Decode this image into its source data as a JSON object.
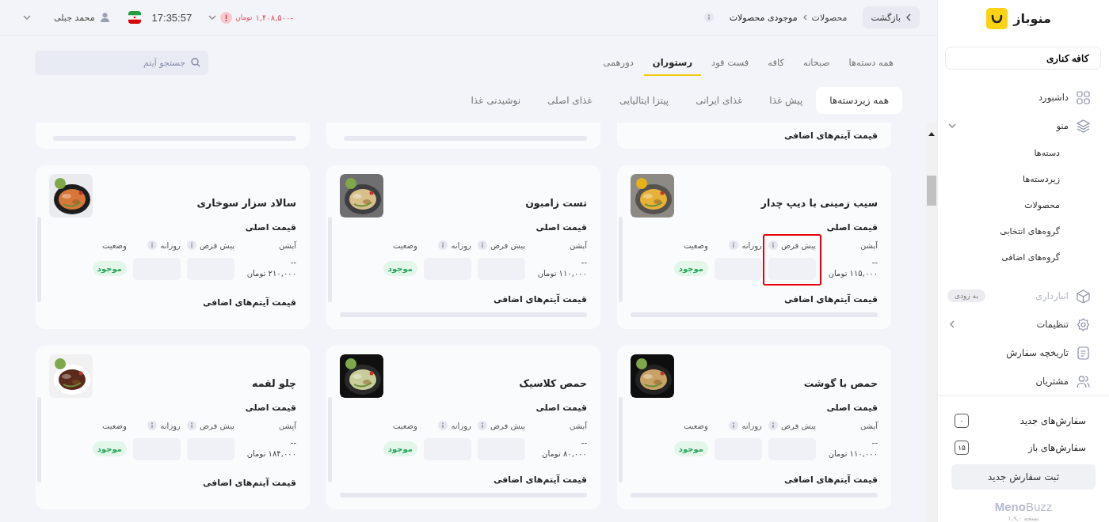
{
  "header": {
    "back_button": "بازگشت",
    "breadcrumb": [
      {
        "label": "محصولات"
      },
      {
        "label": "موجودی محصولات"
      }
    ],
    "balance": {
      "amount": "-۱,۴۰۸,۵۰۰",
      "currency": "تومان"
    },
    "time": "17:35:57",
    "user": "محمد جبلی"
  },
  "categories": [
    {
      "label": "همه دسته‌ها",
      "selected": false
    },
    {
      "label": "صبحانه",
      "selected": false
    },
    {
      "label": "کافه",
      "selected": false
    },
    {
      "label": "فست فود",
      "selected": false
    },
    {
      "label": "رستوران",
      "selected": true
    },
    {
      "label": "دورهمی",
      "selected": false
    }
  ],
  "search": {
    "placeholder": "جستجو آیتم"
  },
  "subcategories": [
    {
      "label": "همه زیردسته‌ها",
      "selected": true
    },
    {
      "label": "پیش غذا",
      "selected": false
    },
    {
      "label": "غذای ایرانی",
      "selected": false
    },
    {
      "label": "پیتزا ایتالیایی",
      "selected": false
    },
    {
      "label": "غذای اصلی",
      "selected": false
    },
    {
      "label": "نوشیدنی غذا",
      "selected": false
    }
  ],
  "cards_above": [
    {
      "kind": "label",
      "text": "قیمت آیتم‌های اضافی"
    },
    {
      "kind": "bar"
    },
    {
      "kind": "bar"
    }
  ],
  "products": [
    {
      "name": "سیب زمینی با دیپ چدار",
      "main_price_label": "قیمت اصلی",
      "columns": [
        "آپشن",
        "پیش فرض",
        "روزانه",
        "وضعیت"
      ],
      "option": "--",
      "price": "۱۱۵,۰۰۰ تومان",
      "status": "موجود",
      "extras_label": "قیمت آیتم‌های اضافی",
      "extras_bar": true,
      "highlighted": true
    },
    {
      "name": "تست زامبون",
      "main_price_label": "قیمت اصلی",
      "columns": [
        "آپشن",
        "پیش فرض",
        "روزانه",
        "وضعیت"
      ],
      "option": "--",
      "price": "۱۱۰,۰۰۰ تومان",
      "status": "موجود",
      "extras_label": "قیمت آیتم‌های اضافی",
      "extras_bar": true,
      "highlighted": false
    },
    {
      "name": "سالاد سزار سوخاری",
      "main_price_label": "قیمت اصلی",
      "columns": [
        "آپشن",
        "پیش فرض",
        "روزانه",
        "وضعیت"
      ],
      "option": "--",
      "price": "۲۱۰,۰۰۰ تومان",
      "status": "موجود",
      "extras_label": "قیمت آیتم‌های اضافی",
      "extras_bar": false,
      "highlighted": false
    },
    {
      "name": "حمص با گوشت",
      "main_price_label": "قیمت اصلی",
      "columns": [
        "آپشن",
        "پیش فرض",
        "روزانه",
        "وضعیت"
      ],
      "option": "--",
      "price": "۱۱۰,۰۰۰ تومان",
      "status": "موجود",
      "extras_label": "قیمت آیتم‌های اضافی",
      "extras_bar": true,
      "highlighted": false
    },
    {
      "name": "حمص کلاسیک",
      "main_price_label": "قیمت اصلی",
      "columns": [
        "آپشن",
        "پیش فرض",
        "روزانه",
        "وضعیت"
      ],
      "option": "--",
      "price": "۸۰,۰۰۰ تومان",
      "status": "موجود",
      "extras_label": "قیمت آیتم‌های اضافی",
      "extras_bar": true,
      "highlighted": false
    },
    {
      "name": "چلو لقمه",
      "main_price_label": "قیمت اصلی",
      "columns": [
        "آپشن",
        "پیش فرض",
        "روزانه",
        "وضعیت"
      ],
      "option": "--",
      "price": "۱۸۴,۰۰۰ تومان",
      "status": "موجود",
      "extras_label": "قیمت آیتم‌های اضافی",
      "extras_bar": false,
      "highlighted": false
    }
  ],
  "sidebar": {
    "brand": "منوباز",
    "branch": "کافه کناری",
    "items": [
      {
        "label": "داشبورد",
        "disabled": false
      },
      {
        "label": "منو",
        "disabled": false,
        "expanded": true,
        "children": [
          {
            "label": "دسته‌ها"
          },
          {
            "label": "زیردسته‌ها"
          },
          {
            "label": "محصولات"
          },
          {
            "label": "گروه‌های انتخابی"
          },
          {
            "label": "گروه‌های اضافی"
          }
        ]
      },
      {
        "label": "انبارداری",
        "disabled": true,
        "badge": "به زودی"
      },
      {
        "label": "تنظیمات",
        "disabled": false,
        "expanded": false
      },
      {
        "label": "تاریخچه سفارش",
        "disabled": false
      },
      {
        "label": "مشتریان",
        "disabled": false
      }
    ],
    "orders": [
      {
        "label": "سفارش‌های جدید",
        "count": "۰"
      },
      {
        "label": "سفارش‌های باز",
        "count": "۱۵"
      }
    ],
    "new_order_button": "ثبت سفارش جدید",
    "footer_brand": "**Meno**Buzz",
    "version": "نسخه ۱,۹,۰"
  }
}
